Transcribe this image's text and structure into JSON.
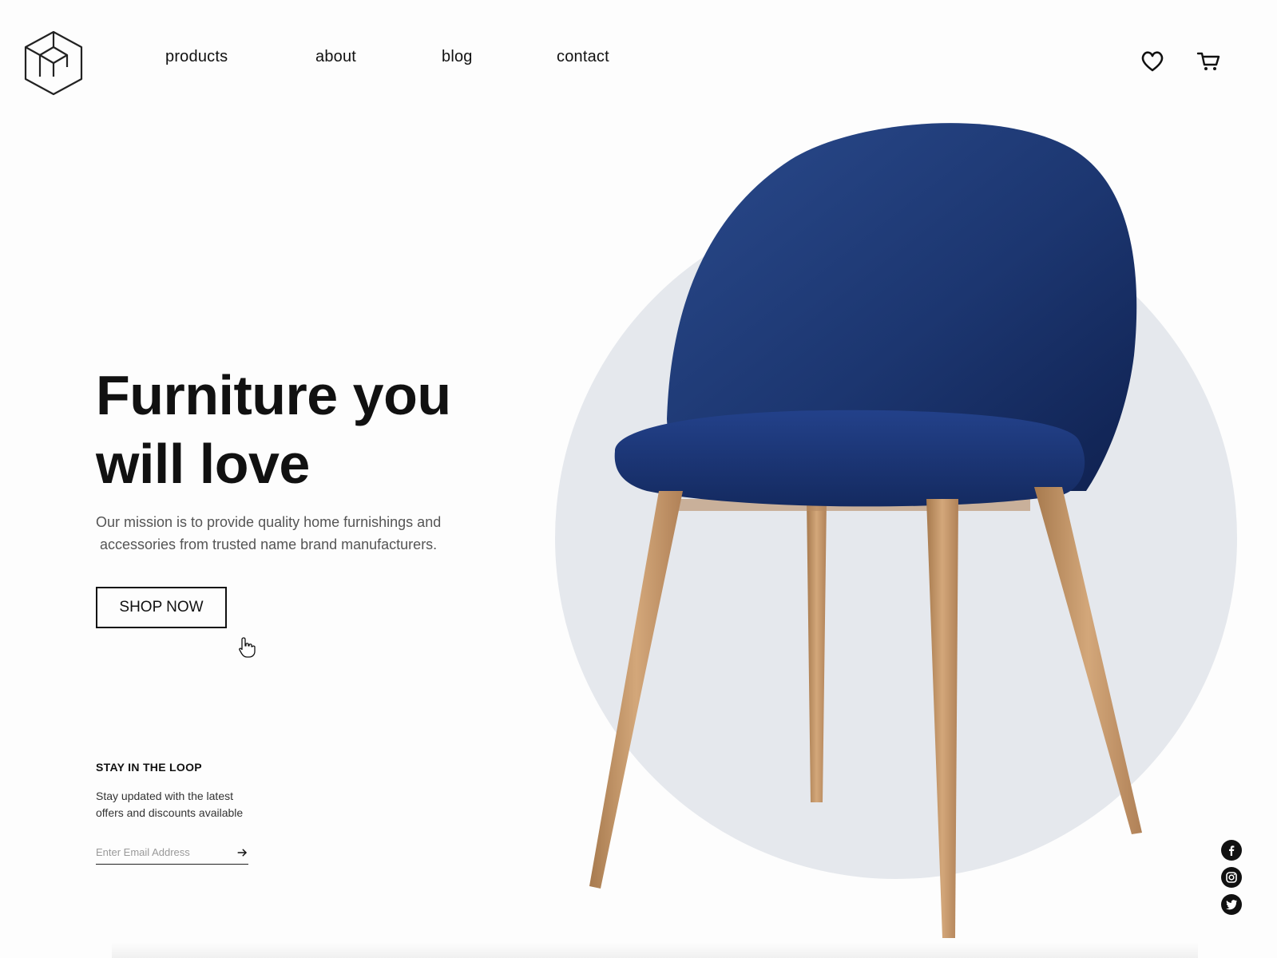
{
  "nav": {
    "items": [
      {
        "label": "products"
      },
      {
        "label": "about"
      },
      {
        "label": "blog"
      },
      {
        "label": "contact"
      }
    ]
  },
  "header": {
    "logo_icon": "box-cube-logo",
    "wishlist_icon": "heart-icon",
    "cart_icon": "cart-icon"
  },
  "hero": {
    "headline_line1": "Furniture you",
    "headline_line2": "will love",
    "mission_line1": "Our mission is to provide quality home furnishings and",
    "mission_line2": " accessories from trusted name brand manufacturers.",
    "cta_label": "SHOP NOW",
    "image": "blue-velvet-chair-with-wooden-legs"
  },
  "newsletter": {
    "title": "STAY IN THE LOOP",
    "description_line1": "Stay updated with the latest",
    "description_line2": "offers and discounts available",
    "email_placeholder": "Enter Email Address",
    "submit_icon": "arrow-right-icon"
  },
  "social": [
    "facebook-icon",
    "instagram-icon",
    "twitter-icon"
  ],
  "colors": {
    "background": "#fdfdfd",
    "circle": "#e5e8ed",
    "chair_blue": "#1d3a78",
    "wood": "#c99a6a",
    "text": "#111111"
  }
}
